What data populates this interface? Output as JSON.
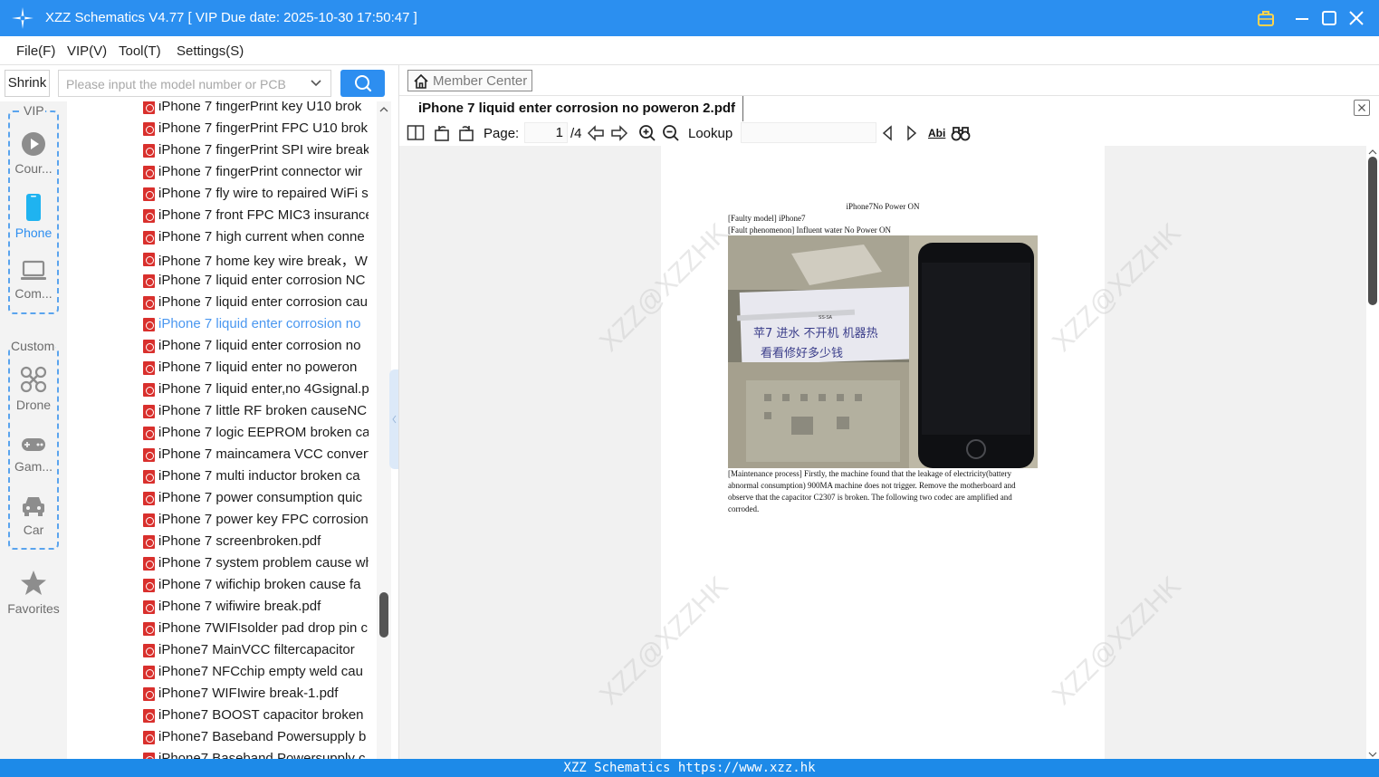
{
  "window": {
    "title": "XZZ Schematics V4.77 [ VIP Due date: 2025-10-30 17:50:47 ]"
  },
  "menu": [
    "File(F)",
    "VIP(V)",
    "Tool(T)",
    "Settings(S)"
  ],
  "search": {
    "shrink_label": "Shrink",
    "placeholder": "Please input the model number or PCB"
  },
  "sidebar": {
    "vip_group_label": "VIP",
    "custom_group_label": "Custom",
    "items": [
      {
        "label": "Cour...",
        "icon": "play-icon"
      },
      {
        "label": "Phone",
        "icon": "phone-icon",
        "active": true
      },
      {
        "label": "Com...",
        "icon": "laptop-icon"
      },
      {
        "label": "Drone",
        "icon": "drone-icon"
      },
      {
        "label": "Gam...",
        "icon": "gamepad-icon"
      },
      {
        "label": "Car",
        "icon": "car-icon"
      },
      {
        "label": "Favorites",
        "icon": "star-icon"
      }
    ]
  },
  "files": [
    "iPhone 7 fingerPrint  key U10 brok",
    "iPhone 7 fingerPrint FPC U10 brok",
    "iPhone 7 fingerPrint SPI wire break",
    "iPhone 7 fingerPrint connector wir",
    "iPhone 7 fly wire to repaired WiFi s",
    "iPhone 7 front FPC MIC3 insurance",
    "iPhone 7 high current when conne",
    "iPhone 7 home key wire break，W",
    "iPhone 7 liquid enter corrosion NC",
    "iPhone 7 liquid enter corrosion cau",
    "iPhone 7 liquid enter corrosion no",
    "iPhone 7 liquid enter corrosion no",
    "iPhone 7 liquid enter no poweron",
    "iPhone 7 liquid enter,no 4Gsignal.p",
    "iPhone 7 little RF  broken causeNC",
    "iPhone 7 logic EEPROM  broken ca",
    "iPhone 7 maincamera VCC convert",
    "iPhone 7 multi inductor broken ca",
    "iPhone 7 power consumption quic",
    "iPhone 7 power key FPC corrosion",
    "iPhone 7 screenbroken.pdf",
    "iPhone 7 system problem cause wh",
    "iPhone 7 wifichip  broken cause fa",
    "iPhone 7 wifiwire break.pdf",
    "iPhone 7WIFIsolder pad drop pin c",
    "iPhone7  MainVCC filtercapacitor",
    "iPhone7  NFCchip empty weld cau",
    "iPhone7  WIFIwire break-1.pdf",
    "iPhone7 BOOST capacitor  broken",
    "iPhone7 Baseband Powersupply  b",
    "iPhone7 Baseband Powersupply c"
  ],
  "selected_file_index": 10,
  "viewer": {
    "member_center": "Member Center",
    "tab_title": "iPhone 7 liquid enter corrosion no poweron 2.pdf",
    "page_label": "Page:",
    "page_current": "1",
    "page_total": "/4",
    "lookup_label": "Lookup",
    "find_icon_text": "Abi"
  },
  "document": {
    "title": "iPhone7No Power ON",
    "faulty_model": "[Faulty model] iPhone7",
    "fault_phenomenon": "[Fault phenomenon] Influent water No Power ON",
    "maintenance": "[Maintenance process] Firstly, the machine found that the leakage of electricity(battery abnormal consumption) 900MA machine does not trigger. Remove the motherboard and observe that the capacitor C2307 is broken. The following two codec are amplified and corroded.",
    "watermark": "XZZ@XZZHK",
    "photo_handwriting_1": "苹7 进水 不开机 机器热",
    "photo_handwriting_2": "看看修好多少钱",
    "photo_tweezer_label": "SS-SA"
  },
  "statusbar": "XZZ Schematics https://www.xzz.hk",
  "colors": {
    "titlebar": "#2b8ff0",
    "accent": "#2d8ef0",
    "pdf_icon": "#d9302d",
    "statusbar": "#1d8ae8"
  }
}
